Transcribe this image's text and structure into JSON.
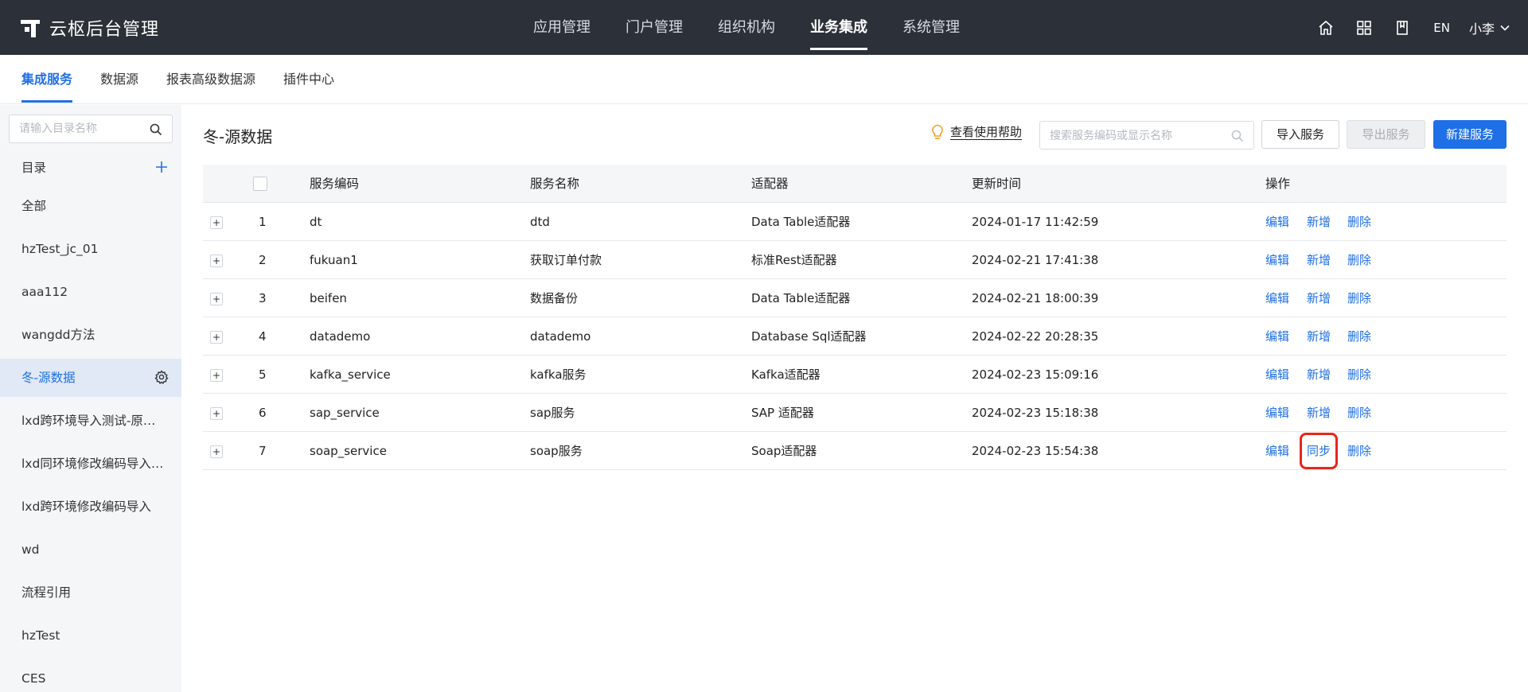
{
  "app": {
    "title": "云枢后台管理"
  },
  "topnav": {
    "items": [
      "应用管理",
      "门户管理",
      "组织机构",
      "业务集成",
      "系统管理"
    ],
    "active_index": 3
  },
  "topright": {
    "lang": "EN",
    "user": "小李"
  },
  "subnav": {
    "items": [
      "集成服务",
      "数据源",
      "报表高级数据源",
      "插件中心"
    ],
    "active_index": 0
  },
  "sidebar": {
    "search_placeholder": "请输入目录名称",
    "header": "目录",
    "items": [
      "全部",
      "hzTest_jc_01",
      "aaa112",
      "wangdd方法",
      "冬-源数据",
      "lxd跨环境导入测试-原数据…",
      "lxd同环境修改编码导入…",
      "lxd跨环境修改编码导入",
      "wd",
      "流程引用",
      "hzTest",
      "CES"
    ],
    "active_index": 4
  },
  "main": {
    "title": "冬-源数据",
    "help_label": "查看使用帮助",
    "search_placeholder": "搜索服务编码或显示名称",
    "buttons": {
      "import": "导入服务",
      "export": "导出服务",
      "new": "新建服务"
    }
  },
  "table": {
    "headers": {
      "code": "服务编码",
      "name": "服务名称",
      "adapter": "适配器",
      "updated": "更新时间",
      "actions": "操作"
    },
    "rows": [
      {
        "index": "1",
        "code": "dt",
        "name": "dtd",
        "adapter": "Data Table适配器",
        "updated": "2024-01-17 11:42:59",
        "ops": [
          "编辑",
          "新增",
          "删除"
        ]
      },
      {
        "index": "2",
        "code": "fukuan1",
        "name": "获取订单付款",
        "adapter": "标准Rest适配器",
        "updated": "2024-02-21 17:41:38",
        "ops": [
          "编辑",
          "新增",
          "删除"
        ]
      },
      {
        "index": "3",
        "code": "beifen",
        "name": "数据备份",
        "adapter": "Data Table适配器",
        "updated": "2024-02-21 18:00:39",
        "ops": [
          "编辑",
          "新增",
          "删除"
        ]
      },
      {
        "index": "4",
        "code": "datademo",
        "name": "datademo",
        "adapter": "Database Sql适配器",
        "updated": "2024-02-22 20:28:35",
        "ops": [
          "编辑",
          "新增",
          "删除"
        ]
      },
      {
        "index": "5",
        "code": "kafka_service",
        "name": "kafka服务",
        "adapter": "Kafka适配器",
        "updated": "2024-02-23 15:09:16",
        "ops": [
          "编辑",
          "新增",
          "删除"
        ]
      },
      {
        "index": "6",
        "code": "sap_service",
        "name": "sap服务",
        "adapter": "SAP 适配器",
        "updated": "2024-02-23 15:18:38",
        "ops": [
          "编辑",
          "新增",
          "删除"
        ]
      },
      {
        "index": "7",
        "code": "soap_service",
        "name": "soap服务",
        "adapter": "Soap适配器",
        "updated": "2024-02-23 15:54:38",
        "ops": [
          "编辑",
          "同步",
          "删除"
        ]
      }
    ],
    "highlight": {
      "row": 6,
      "op": 1
    }
  },
  "colors": {
    "accent": "#1f6fe6",
    "topbar": "#2c3038",
    "highlight": "#e8261b"
  }
}
